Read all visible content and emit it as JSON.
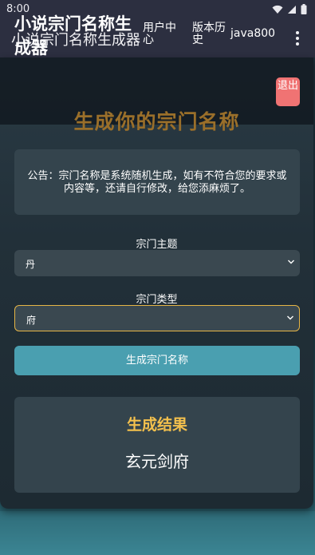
{
  "status_bar": {
    "time": "8:00"
  },
  "app_bar": {
    "title": "小说宗门名称生成器"
  },
  "site": {
    "title": "小说宗门名称生成器",
    "nav": {
      "user_center": "用户中心",
      "version_history": "版本历史",
      "username": "java800",
      "logout": "退出"
    }
  },
  "main": {
    "heading": "生成你的宗门名称",
    "notice": "公告：宗门名称是系统随机生成，如有不符合您的要求或内容等，还请自行修改，给您添麻烦了。",
    "theme": {
      "label": "宗门主题",
      "value": "丹"
    },
    "type": {
      "label": "宗门类型",
      "value": "府"
    },
    "generate_button": "生成宗门名称",
    "result": {
      "title": "生成结果",
      "value": "玄元剑府"
    }
  },
  "colors": {
    "accent_gold": "#f3c04d",
    "button": "#4a9fb0",
    "logout": "#f07373",
    "focus_border": "#e6b545"
  },
  "icons": [
    "wifi-icon",
    "signal-icon",
    "battery-icon",
    "overflow-menu-icon",
    "chevron-down-icon"
  ]
}
